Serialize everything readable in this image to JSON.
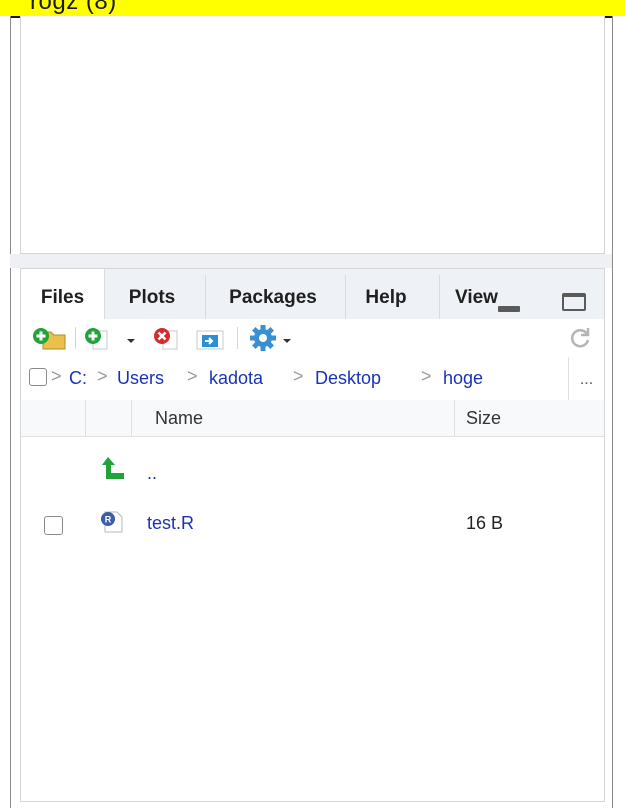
{
  "top_banner": {
    "text": "rogz (8)"
  },
  "tabs": [
    {
      "label": "Files",
      "active": true
    },
    {
      "label": "Plots",
      "active": false
    },
    {
      "label": "Packages",
      "active": false
    },
    {
      "label": "Help",
      "active": false
    },
    {
      "label": "View",
      "active": false
    }
  ],
  "toolbar": {
    "icons": [
      "new-folder-icon",
      "new-file-icon",
      "dropdown-arrow-icon",
      "delete-icon",
      "rename-icon",
      "gear-icon",
      "refresh-icon"
    ]
  },
  "path": {
    "crumbs": [
      "C:",
      "Users",
      "kadota",
      "Desktop",
      "hoge"
    ],
    "more_label": "..."
  },
  "table": {
    "headers": {
      "name": "Name",
      "size": "Size"
    },
    "parent_label": "..",
    "rows": [
      {
        "name": "test.R",
        "size": "16 B",
        "icon": "r-file-icon"
      }
    ]
  },
  "colors": {
    "accent_green": "#22a33a",
    "link_blue": "#1a33b5",
    "delete_red": "#d42c2c",
    "banner_yellow": "#ffff00"
  }
}
